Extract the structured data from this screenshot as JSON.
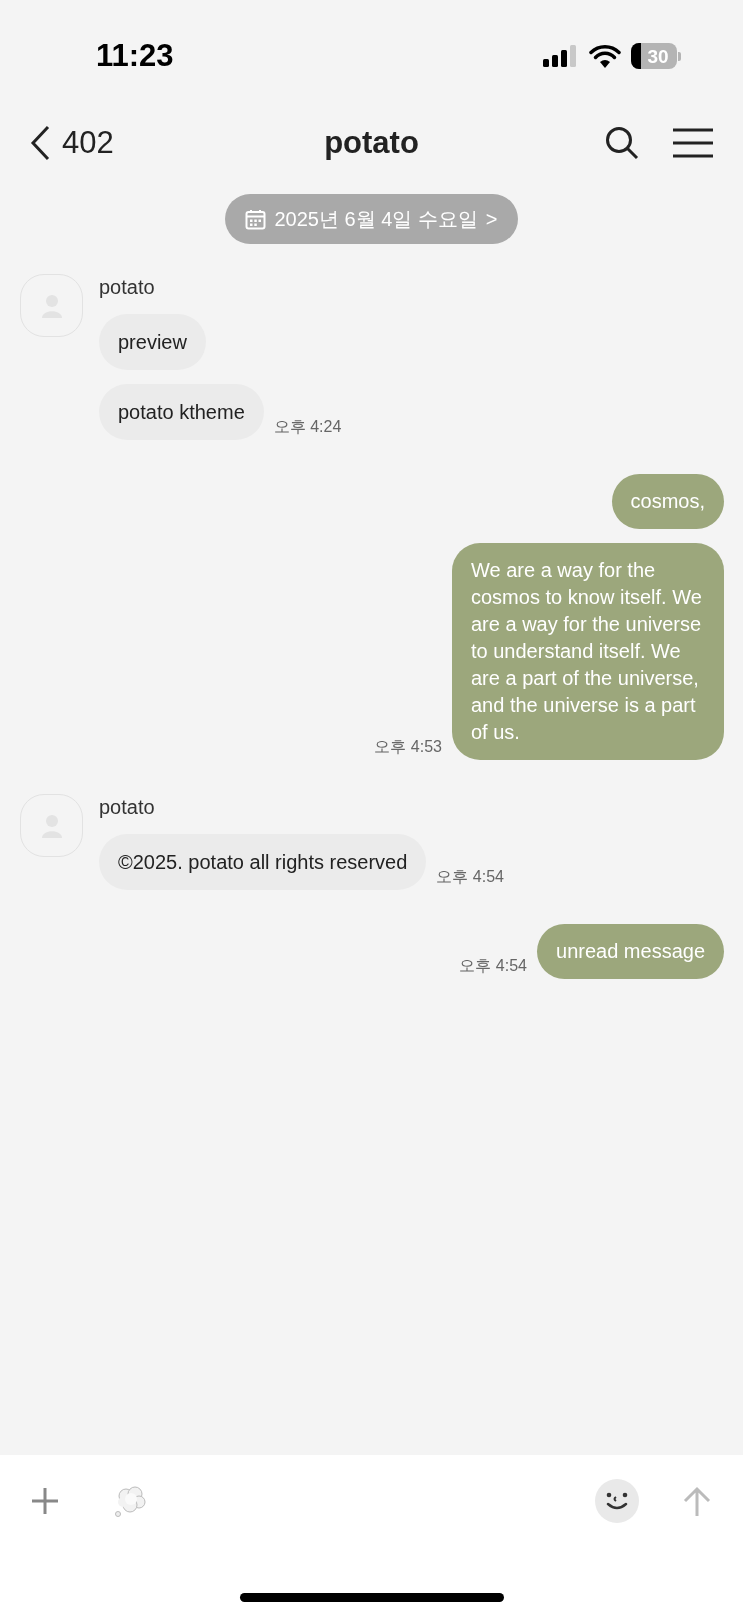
{
  "status_bar": {
    "time": "11:23",
    "battery": "30"
  },
  "header": {
    "back_label": "402",
    "title": "potato"
  },
  "date_chip": {
    "label": "2025년 6월 4일 수요일",
    "chevron": ">"
  },
  "messages": [
    {
      "kind": "received",
      "sender": "potato",
      "bubbles": [
        "preview",
        "potato ktheme"
      ],
      "time": "오후 4:24"
    },
    {
      "kind": "sent",
      "bubbles": [
        "cosmos,",
        "We are a way for the cosmos to know itself. We are a way for the universe to understand itself. We are a part of the universe, and the universe is a part of us."
      ],
      "time": "오후 4:53"
    },
    {
      "kind": "received",
      "sender": "potato",
      "bubbles": [
        "©2025. potato all rights reserved"
      ],
      "time": "오후 4:54"
    },
    {
      "kind": "sent",
      "bubbles": [
        "unread message"
      ],
      "time": "오후 4:54"
    }
  ]
}
